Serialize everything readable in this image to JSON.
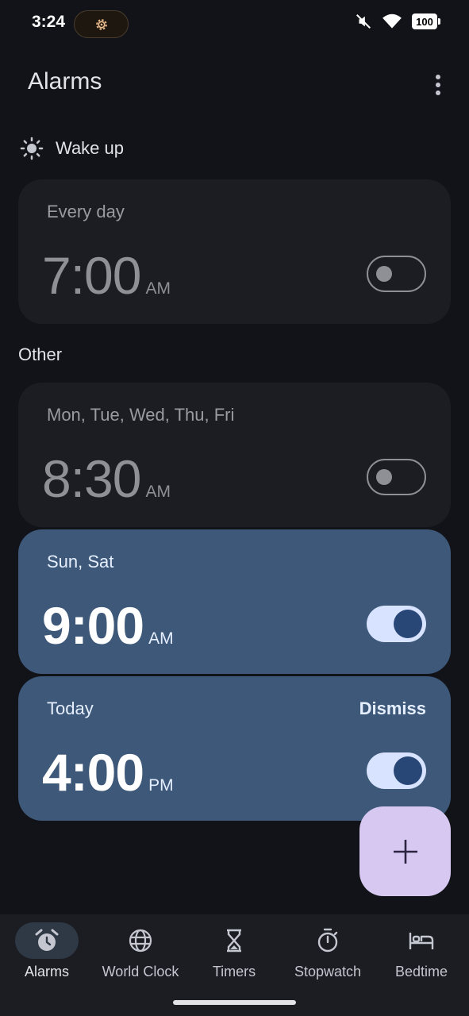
{
  "status_bar": {
    "time": "3:24",
    "battery": "100",
    "icons": [
      "gear-icon",
      "mute-icon",
      "wifi-icon",
      "battery-icon"
    ]
  },
  "header": {
    "title": "Alarms",
    "menu_icon": "more-vert-icon"
  },
  "wakeup_section": {
    "label": "Wake up",
    "icon": "sun-icon",
    "alarm": {
      "days": "Every day",
      "time": "7:00",
      "ampm": "AM",
      "enabled": false
    }
  },
  "other_section": {
    "label": "Other",
    "alarms": [
      {
        "days": "Mon, Tue, Wed, Thu, Fri",
        "time": "8:30",
        "ampm": "AM",
        "enabled": false
      },
      {
        "days": "Sun, Sat",
        "time": "9:00",
        "ampm": "AM",
        "enabled": true
      },
      {
        "days": "Today",
        "time": "4:00",
        "ampm": "PM",
        "enabled": true,
        "action": "Dismiss"
      }
    ]
  },
  "fab": {
    "icon": "plus-icon"
  },
  "bottom_nav": {
    "items": [
      {
        "label": "Alarms",
        "icon": "alarm-clock-icon",
        "active": true
      },
      {
        "label": "World Clock",
        "icon": "globe-icon",
        "active": false
      },
      {
        "label": "Timers",
        "icon": "hourglass-icon",
        "active": false
      },
      {
        "label": "Stopwatch",
        "icon": "stopwatch-icon",
        "active": false
      },
      {
        "label": "Bedtime",
        "icon": "bed-icon",
        "active": false
      }
    ]
  },
  "colors": {
    "background": "#111318",
    "card_off": "#1b1d23",
    "card_on": "#3d5878",
    "toggle_on": "#d7e3ff",
    "fab": "#d7c8f2"
  }
}
